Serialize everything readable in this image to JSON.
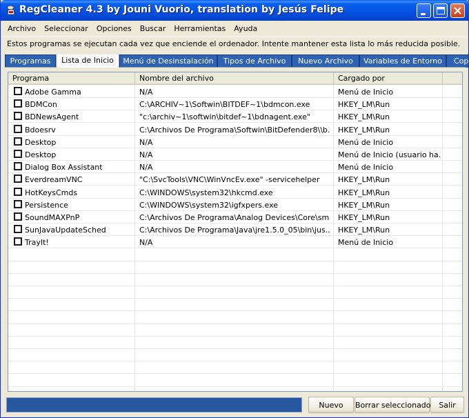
{
  "window": {
    "title": "RegCleaner 4.3 by Jouni Vuorio, translation by Jesús Felipe",
    "icon": "regcleaner-app-icon"
  },
  "menu": [
    "Archivo",
    "Seleccionar",
    "Opciones",
    "Buscar",
    "Herramientas",
    "Ayuda"
  ],
  "info_text": "Estos programas se ejecutan cada vez que enciende el ordenador. Intente mantener esta lista lo más reducida posible.",
  "tabs": [
    "Programas",
    "Lista de Inicio",
    "Menú de Desinstalación",
    "Tipos de Archivo",
    "Nuevo Archivo",
    "Variables de Entorno",
    "Cop"
  ],
  "active_tab": "Lista de Inicio",
  "columns": [
    "Programa",
    "Nombre del archivo",
    "Cargado por"
  ],
  "rows": [
    {
      "programa": "Adobe Gamma",
      "archivo": "N/A",
      "cargado": "Menú de Inicio"
    },
    {
      "programa": "BDMCon",
      "archivo": "C:\\ARCHIV~1\\Softwin\\BITDEF~1\\bdmcon.exe",
      "cargado": "HKEY_LM\\Run"
    },
    {
      "programa": "BDNewsAgent",
      "archivo": "\"c:\\archiv~1\\softwin\\bitdef~1\\bdnagent.exe\"",
      "cargado": "HKEY_LM\\Run"
    },
    {
      "programa": "Bdoesrv",
      "archivo": "C:\\Archivos De Programa\\Softwin\\BitDefender8\\\\b...",
      "cargado": "HKEY_LM\\Run"
    },
    {
      "programa": "Desktop",
      "archivo": "N/A",
      "cargado": "Menú de Inicio"
    },
    {
      "programa": "Desktop",
      "archivo": "N/A",
      "cargado": "Menú de Inicio (usuario ha..."
    },
    {
      "programa": "Dialog Box Assistant",
      "archivo": "N/A",
      "cargado": "Menú de Inicio"
    },
    {
      "programa": "EverdreamVNC",
      "archivo": "\"C:\\SvcTools\\VNC\\WinVncEv.exe\" -servicehelper",
      "cargado": "HKEY_LM\\Run"
    },
    {
      "programa": "HotKeysCmds",
      "archivo": "C:\\WINDOWS\\system32\\hkcmd.exe",
      "cargado": "HKEY_LM\\Run"
    },
    {
      "programa": "Persistence",
      "archivo": "C:\\WINDOWS\\system32\\igfxpers.exe",
      "cargado": "HKEY_LM\\Run"
    },
    {
      "programa": "SoundMAXPnP",
      "archivo": "C:\\Archivos De Programa\\Analog Devices\\Core\\sm...",
      "cargado": "HKEY_LM\\Run"
    },
    {
      "programa": "SunJavaUpdateSched",
      "archivo": "C:\\Archivos De Programa\\Java\\jre1.5.0_05\\bin\\jus...",
      "cargado": "HKEY_LM\\Run"
    },
    {
      "programa": "TrayIt!",
      "archivo": "N/A",
      "cargado": "Menú de Inicio"
    }
  ],
  "buttons": {
    "nuevo": "Nuevo",
    "borrar": "Borrar seleccionado",
    "salir": "Salir"
  },
  "colors": {
    "titlebar": "#0550e0",
    "tab_inactive": "#2e63b4",
    "status_bar": "#27579e"
  }
}
